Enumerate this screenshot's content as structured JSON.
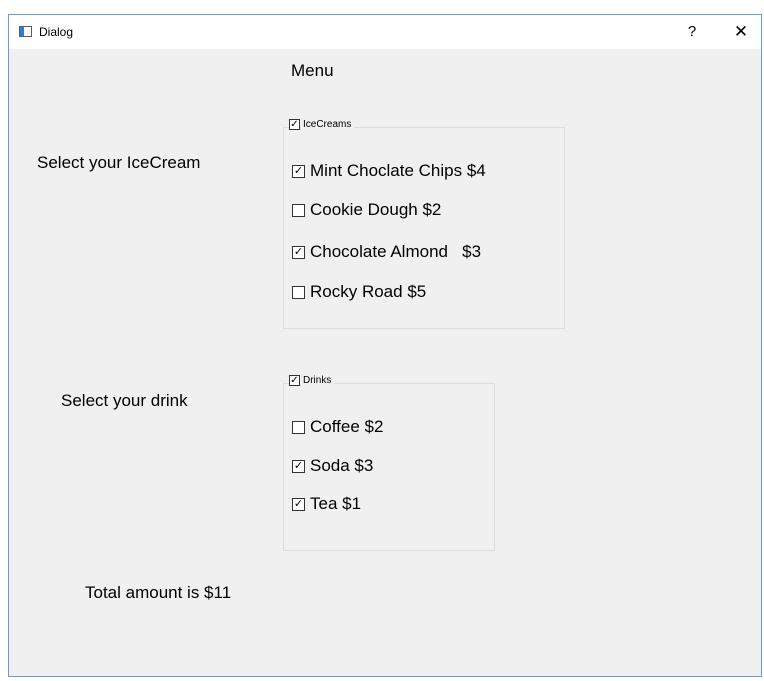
{
  "window": {
    "title": "Dialog",
    "help_glyph": "?",
    "close_glyph": "✕"
  },
  "menu_heading": "Menu",
  "icecream": {
    "prompt": "Select your IceCream",
    "group_label": "IceCreams",
    "group_checked": true,
    "items": [
      {
        "label": "Mint Choclate Chips $4",
        "checked": true
      },
      {
        "label": "Cookie Dough $2",
        "checked": false
      },
      {
        "label": "Chocolate Almond   $3",
        "checked": true
      },
      {
        "label": "Rocky Road $5",
        "checked": false
      }
    ]
  },
  "drinks": {
    "prompt": "Select your drink",
    "group_label": "Drinks",
    "group_checked": true,
    "items": [
      {
        "label": "Coffee $2",
        "checked": false
      },
      {
        "label": "Soda $3",
        "checked": true
      },
      {
        "label": "Tea $1",
        "checked": true
      }
    ]
  },
  "total_text": "Total amount is $11",
  "colors": {
    "window_bg": "#f0f0f0",
    "titlebar_bg": "#ffffff",
    "window_border": "#6a9bd1",
    "group_border": "#dcdcdc"
  }
}
